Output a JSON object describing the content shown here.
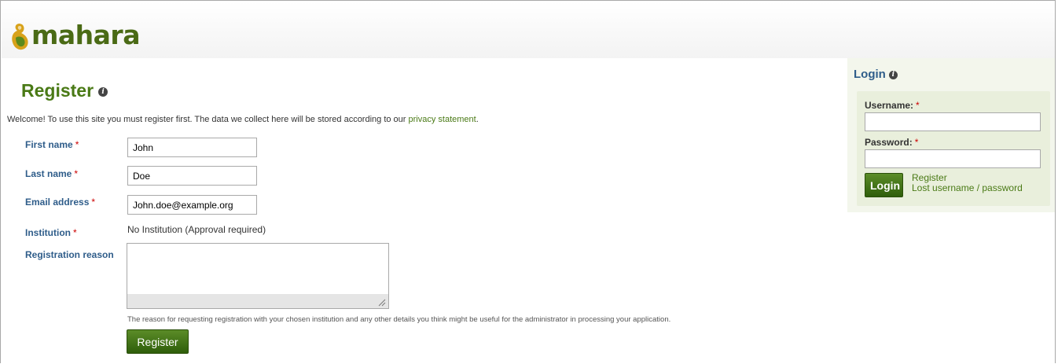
{
  "brand": {
    "logo_text": "mahara",
    "logo_color": "#4a6a15"
  },
  "page": {
    "title": "Register",
    "intro_prefix": "Welcome! To use this site you must register first. The data we collect here will be stored according to our ",
    "intro_link": "privacy statement",
    "intro_suffix": "."
  },
  "form": {
    "required_marker": "*",
    "first_name": {
      "label": "First name",
      "value": "John"
    },
    "last_name": {
      "label": "Last name",
      "value": "Doe"
    },
    "email": {
      "label": "Email address",
      "value": "John.doe@example.org"
    },
    "institution": {
      "label": "Institution",
      "value": "No Institution (Approval required)"
    },
    "reason": {
      "label": "Registration reason",
      "value": "",
      "help": "The reason for requesting registration with your chosen institution and any other details you think might be useful for the administrator in processing your application."
    },
    "submit_label": "Register"
  },
  "login": {
    "title": "Login",
    "username_label": "Username:",
    "password_label": "Password:",
    "submit_label": "Login",
    "register_link": "Register",
    "lost_link": "Lost username / password"
  },
  "colors": {
    "accent_green": "#4a7a16",
    "label_blue": "#2f5d8a",
    "required_red": "#cc0000"
  },
  "icons": [
    "info-icon",
    "mahara-logo-icon",
    "resize-grip-icon"
  ]
}
